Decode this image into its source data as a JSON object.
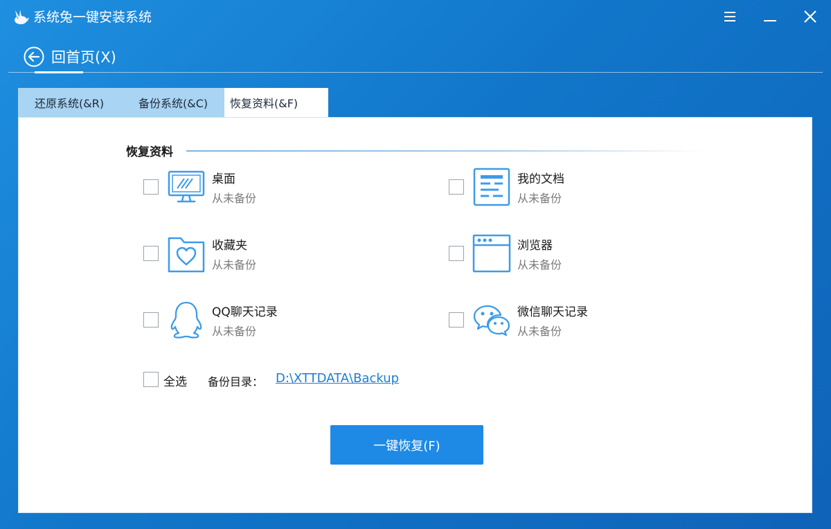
{
  "app": {
    "title": "系统兔一键安装系统"
  },
  "nav": {
    "back_label": "回首页(X)"
  },
  "tabs": [
    {
      "label": "还原系统(&R)",
      "active": false
    },
    {
      "label": "备份系统(&C)",
      "active": false
    },
    {
      "label": "恢复资料(&F)",
      "active": true
    }
  ],
  "section": {
    "title": "恢复资料"
  },
  "items": [
    {
      "name": "桌面",
      "status": "从未备份",
      "icon": "monitor-icon",
      "checked": false
    },
    {
      "name": "我的文档",
      "status": "从未备份",
      "icon": "document-icon",
      "checked": false
    },
    {
      "name": "收藏夹",
      "status": "从未备份",
      "icon": "favorites-folder-icon",
      "checked": false
    },
    {
      "name": "浏览器",
      "status": "从未备份",
      "icon": "browser-window-icon",
      "checked": false
    },
    {
      "name": "QQ聊天记录",
      "status": "从未备份",
      "icon": "qq-penguin-icon",
      "checked": false
    },
    {
      "name": "微信聊天记录",
      "status": "从未备份",
      "icon": "wechat-icon",
      "checked": false
    }
  ],
  "footer": {
    "select_all_label": "全选",
    "backup_dir_label": "备份目录：",
    "backup_dir_path": "D:\\XTTDATA\\Backup"
  },
  "actions": {
    "restore_label": "一键恢复(F)"
  },
  "colors": {
    "accent": "#1e8ae6",
    "icon_blue": "#3d9be8",
    "tab_inactive": "#a9d4f3",
    "link": "#1a7dd6"
  }
}
